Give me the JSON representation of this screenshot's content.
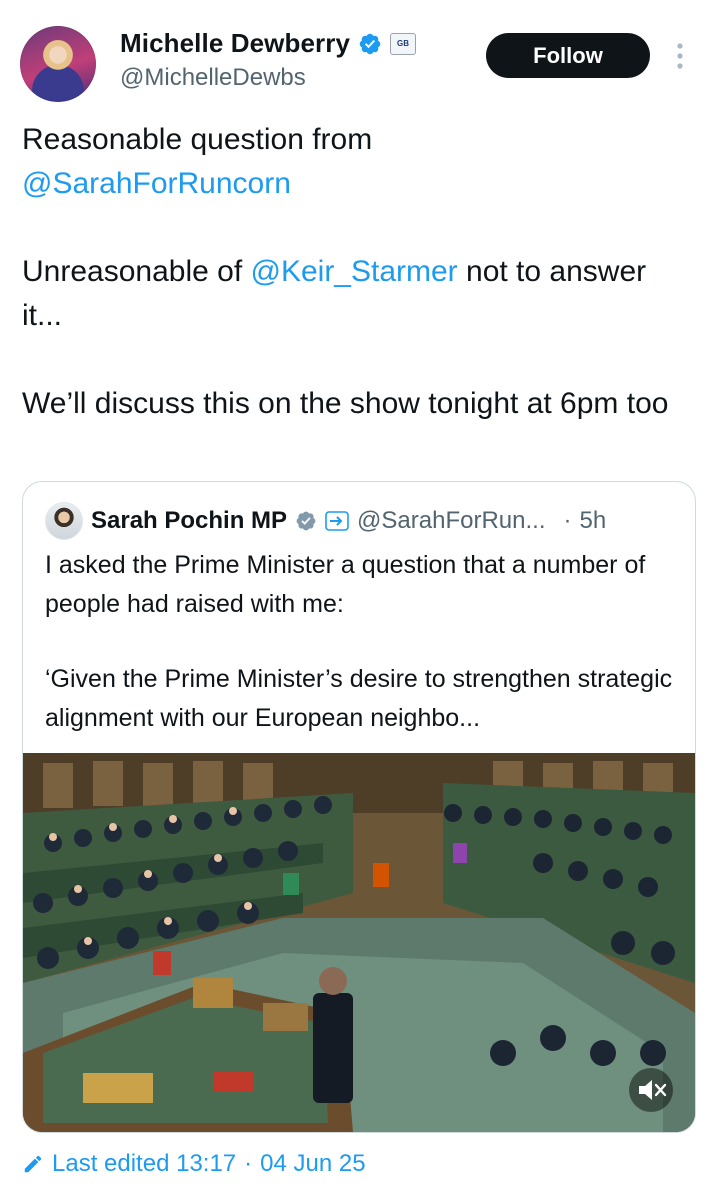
{
  "author": {
    "display_name": "Michelle Dewberry",
    "handle": "@MichelleDewbs",
    "affiliate_badge_text": "GB",
    "avatar_icon": "profile-photo"
  },
  "follow_label": "Follow",
  "tweet": {
    "line1": "Reasonable question from",
    "mention1": "@SarahForRuncorn",
    "line2_pre": "Unreasonable of ",
    "mention2": "@Keir_Starmer",
    "line2_post": " not to answer it...",
    "line3": "We’ll discuss this on the show tonight at 6pm too"
  },
  "quoted": {
    "display_name": "Sarah Pochin MP",
    "handle": "@SarahForRun...",
    "separator": "·",
    "time": "5h",
    "text1": "I asked the Prime Minister a question that a number of people had raised with me:",
    "text2": "‘Given the Prime Minister’s desire to strengthen strategic alignment with our European neighbo..."
  },
  "edited": {
    "label": "Last edited 13:17",
    "separator": " · ",
    "date": "04 Jun 25"
  },
  "colors": {
    "link": "#1d9bf0",
    "verified": "#1d9bf0",
    "text": "#0f1419",
    "secondary": "#536471",
    "follow_bg": "#0f1419"
  },
  "icons": [
    "verified-badge-icon",
    "affiliate-badge-icon",
    "more-options-icon",
    "mute-icon",
    "edit-pencil-icon"
  ]
}
